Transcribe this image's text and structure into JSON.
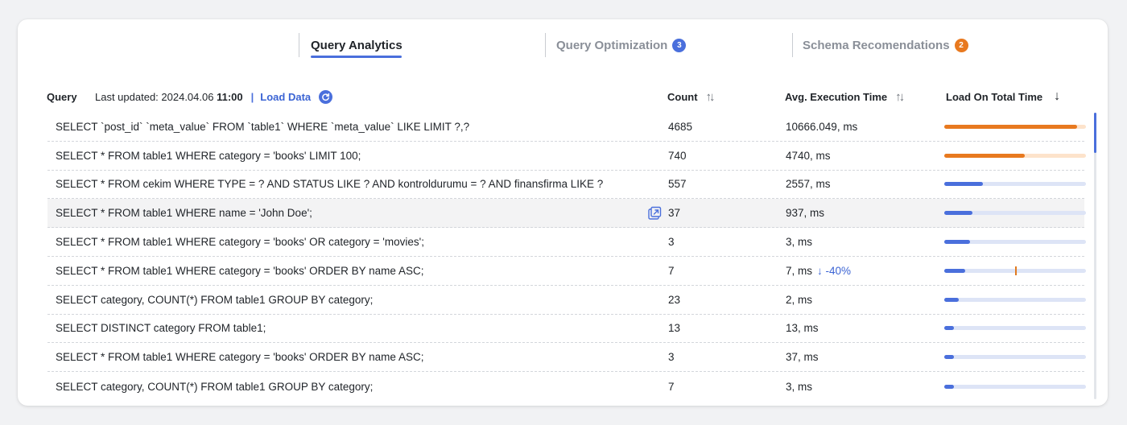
{
  "tabs": [
    {
      "label": "Query Analytics",
      "badge": ""
    },
    {
      "label": "Query Optimization",
      "badge": "3"
    },
    {
      "label": "Schema Recomendations",
      "badge": "2"
    }
  ],
  "colors": {
    "accent": "#4a6fdc",
    "badge_blue": "#4a6fdc",
    "badge_orange": "#e8791f",
    "bar_orange": "#e8791f",
    "bar_orange_track": "#fde3cb",
    "bar_blue": "#4a6fdc",
    "bar_blue_track": "#dde4f6"
  },
  "header": {
    "query_label": "Query",
    "last_updated_prefix": "Last updated: 2024.04.06",
    "last_updated_time": "11:00",
    "separator": "|",
    "load_data_label": "Load Data",
    "count_label": "Count",
    "exec_label": "Avg. Execution Time",
    "load_label": "Load On Total Time"
  },
  "rows": [
    {
      "query": "SELECT `post_id` `meta_value` FROM `table1` WHERE `meta_value` LIKE LIMIT ?,?",
      "count": "4685",
      "exec": "10666.049, ms",
      "trend": "",
      "load": 0.94,
      "color": "orange"
    },
    {
      "query": "SELECT * FROM table1 WHERE category = 'books' LIMIT 100;",
      "count": "740",
      "exec": "4740, ms",
      "trend": "",
      "load": 0.57,
      "color": "orange"
    },
    {
      "query": "SELECT * FROM cekim WHERE TYPE = ? AND STATUS LIKE ? AND kontroldurumu = ? AND finansfirma LIKE ?",
      "count": "557",
      "exec": "2557, ms",
      "trend": "",
      "load": 0.27,
      "color": "blue"
    },
    {
      "query": "SELECT * FROM table1 WHERE name = 'John Doe';",
      "count": "37",
      "exec": "937, ms",
      "trend": "",
      "load": 0.2,
      "color": "blue"
    },
    {
      "query": "SELECT * FROM table1 WHERE category = 'books' OR category = 'movies';",
      "count": "3",
      "exec": "3, ms",
      "trend": "",
      "load": 0.18,
      "color": "blue"
    },
    {
      "query": "SELECT * FROM table1 WHERE category = 'books' ORDER BY name ASC;",
      "count": "7",
      "exec": "7, ms",
      "trend": "↓ -40%",
      "load": 0.15,
      "color": "blue",
      "marker": 0.5
    },
    {
      "query": "SELECT category, COUNT(*) FROM table1 GROUP BY category;",
      "count": "23",
      "exec": "2, ms",
      "trend": "",
      "load": 0.1,
      "color": "blue"
    },
    {
      "query": "SELECT DISTINCT category FROM table1;",
      "count": "13",
      "exec": "13, ms",
      "trend": "",
      "load": 0.07,
      "color": "blue"
    },
    {
      "query": "SELECT * FROM table1 WHERE category = 'books' ORDER BY name ASC;",
      "count": "3",
      "exec": "37, ms",
      "trend": "",
      "load": 0.07,
      "color": "blue"
    },
    {
      "query": "SELECT category, COUNT(*) FROM table1 GROUP BY category;",
      "count": "7",
      "exec": "3, ms",
      "trend": "",
      "load": 0.07,
      "color": "blue"
    }
  ]
}
